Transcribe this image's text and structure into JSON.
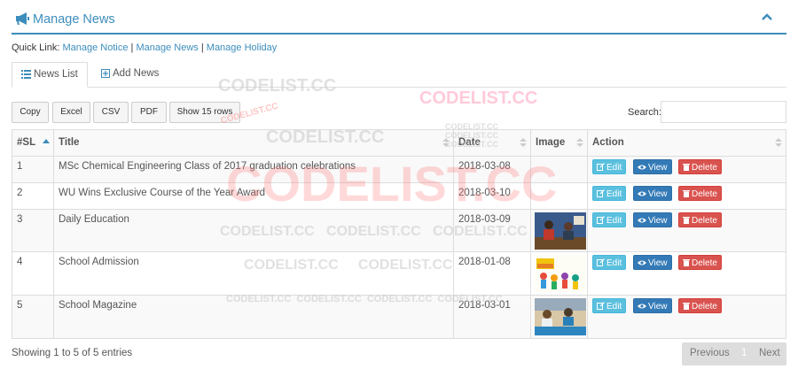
{
  "colors": {
    "accent": "#3c8dbc",
    "info": "#5bc0de",
    "primary": "#337ab7",
    "danger": "#d9534f"
  },
  "header": {
    "title": "Manage News",
    "icon": "bullhorn-icon"
  },
  "quicklinks": {
    "label": "Quick Link:",
    "links": [
      "Manage Notice",
      "Manage News",
      "Manage Holiday"
    ],
    "sep": "|"
  },
  "tabs": [
    {
      "label": "News List",
      "icon": "list-icon"
    },
    {
      "label": "Add News",
      "icon": "plus-square-icon"
    }
  ],
  "toolbar": {
    "buttons": [
      "Copy",
      "Excel",
      "CSV",
      "PDF",
      "Show 15 rows"
    ],
    "search_label": "Search:",
    "search_value": ""
  },
  "table": {
    "columns": [
      "#SL",
      "Title",
      "Date",
      "Image",
      "Action"
    ],
    "rows": [
      {
        "sl": "1",
        "title": "MSc Chemical Engineering Class of 2017 graduation celebrations",
        "date": "2018-03-08",
        "image": ""
      },
      {
        "sl": "2",
        "title": "WU Wins Exclusive Course of the Year Award",
        "date": "2018-03-10",
        "image": ""
      },
      {
        "sl": "3",
        "title": "Daily Education",
        "date": "2018-03-09",
        "image": "classroom-photo"
      },
      {
        "sl": "4",
        "title": "School Admission",
        "date": "2018-01-08",
        "image": "admission-open-photo"
      },
      {
        "sl": "5",
        "title": "School Magazine",
        "date": "2018-03-01",
        "image": "students-desk-photo"
      }
    ],
    "actions": {
      "edit": "Edit",
      "view": "View",
      "delete": "Delete"
    }
  },
  "footer": {
    "info": "Showing 1 to 5 of 5 entries",
    "prev": "Previous",
    "page": "1",
    "next": "Next"
  },
  "watermark": {
    "text": "CODELIST.CC",
    "arc": "CODELIST.CC"
  }
}
